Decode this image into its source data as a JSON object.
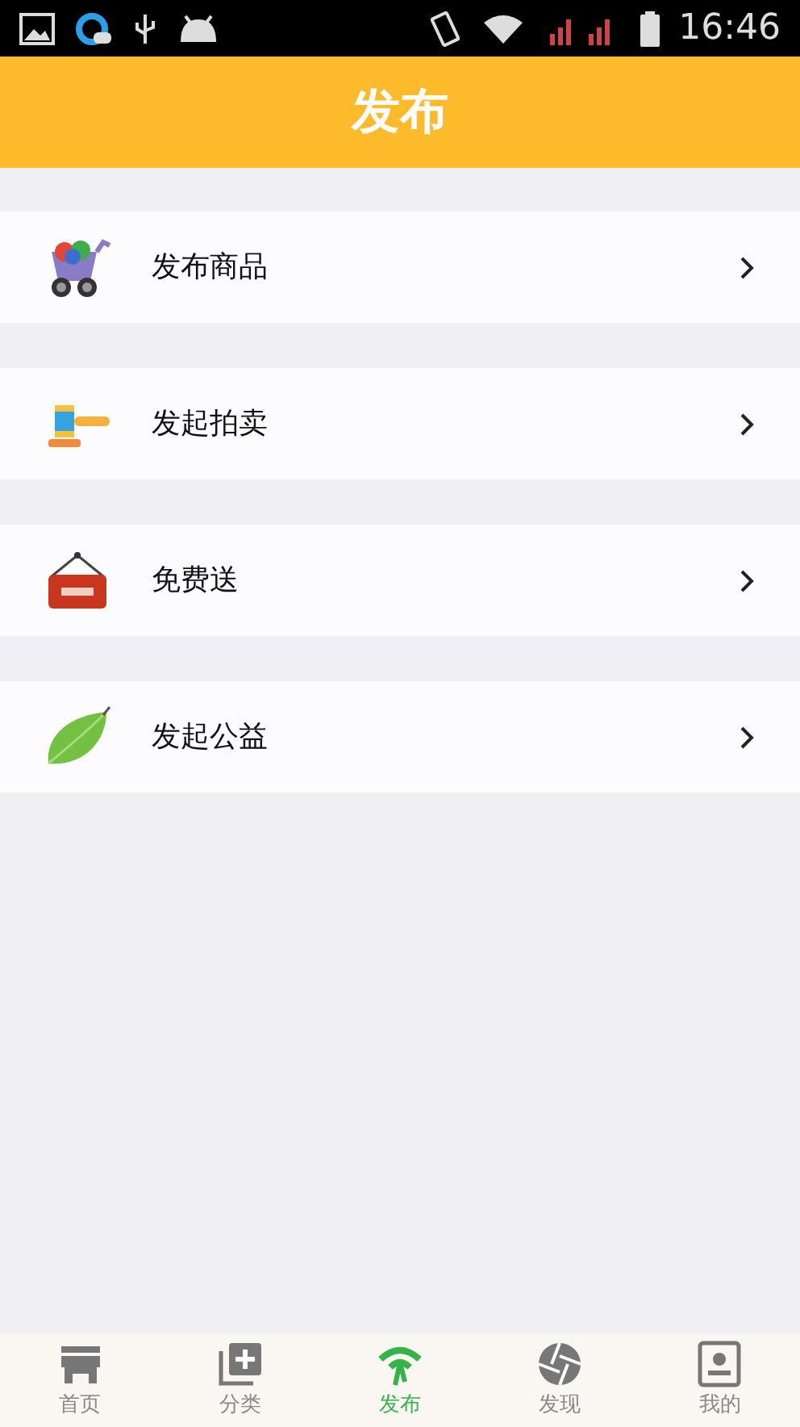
{
  "status_bar": {
    "time": "16:46"
  },
  "header": {
    "title": "发布"
  },
  "menu": [
    {
      "label": "发布商品"
    },
    {
      "label": "发起拍卖"
    },
    {
      "label": "免费送"
    },
    {
      "label": "发起公益"
    }
  ],
  "tabs": [
    {
      "label": "首页",
      "selected": false
    },
    {
      "label": "分类",
      "selected": false
    },
    {
      "label": "发布",
      "selected": true
    },
    {
      "label": "发现",
      "selected": false
    },
    {
      "label": "我的",
      "selected": false
    }
  ]
}
